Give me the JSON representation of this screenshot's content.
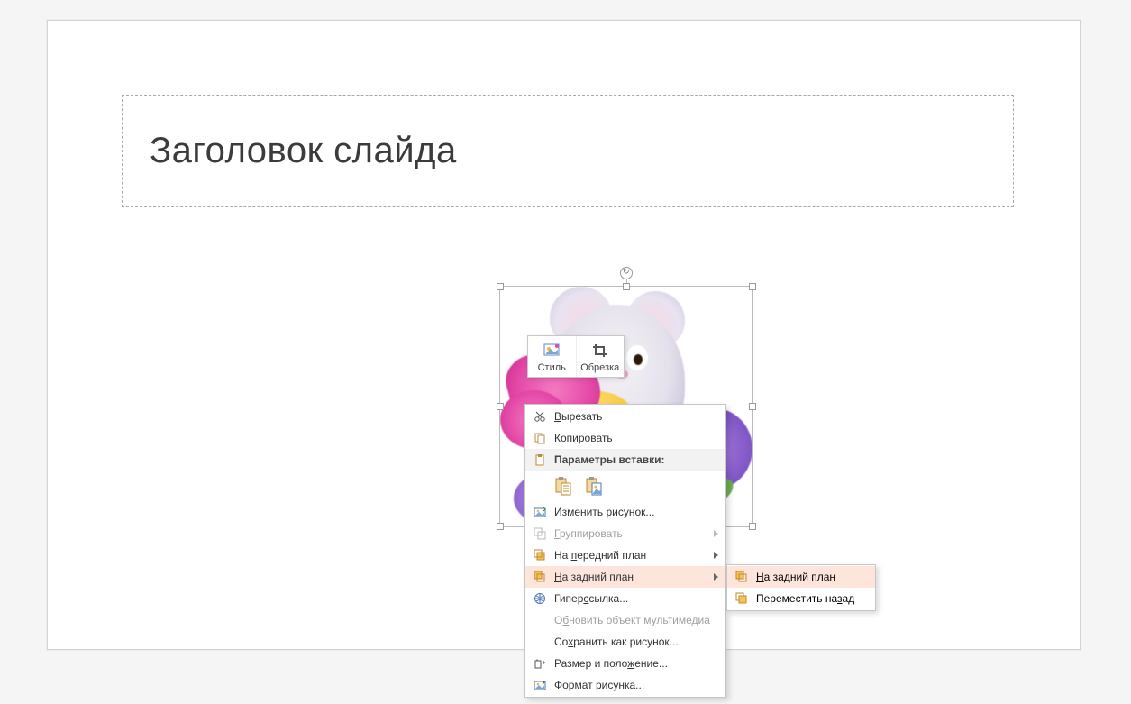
{
  "slide": {
    "title": "Заголовок слайда"
  },
  "mini_toolbar": {
    "style": "Стиль",
    "crop": "Обрезка"
  },
  "context_menu": {
    "cut": "Вырезать",
    "copy": "Копировать",
    "paste_options_header": "Параметры вставки:",
    "change_picture": "Изменить рисунок...",
    "group": "Группировать",
    "bring_to_front": "На передний план",
    "send_to_back": "На задний план",
    "hyperlink": "Гиперссылка...",
    "update_media": "Обновить объект мультимедиа",
    "save_as_picture": "Сохранить как рисунок...",
    "size_and_position": "Размер и положение...",
    "format_picture": "Формат рисунка..."
  },
  "submenu": {
    "send_to_back": "На задний план",
    "send_backward": "Переместить назад"
  },
  "colors": {
    "menu_highlight": "#fde5dc"
  }
}
